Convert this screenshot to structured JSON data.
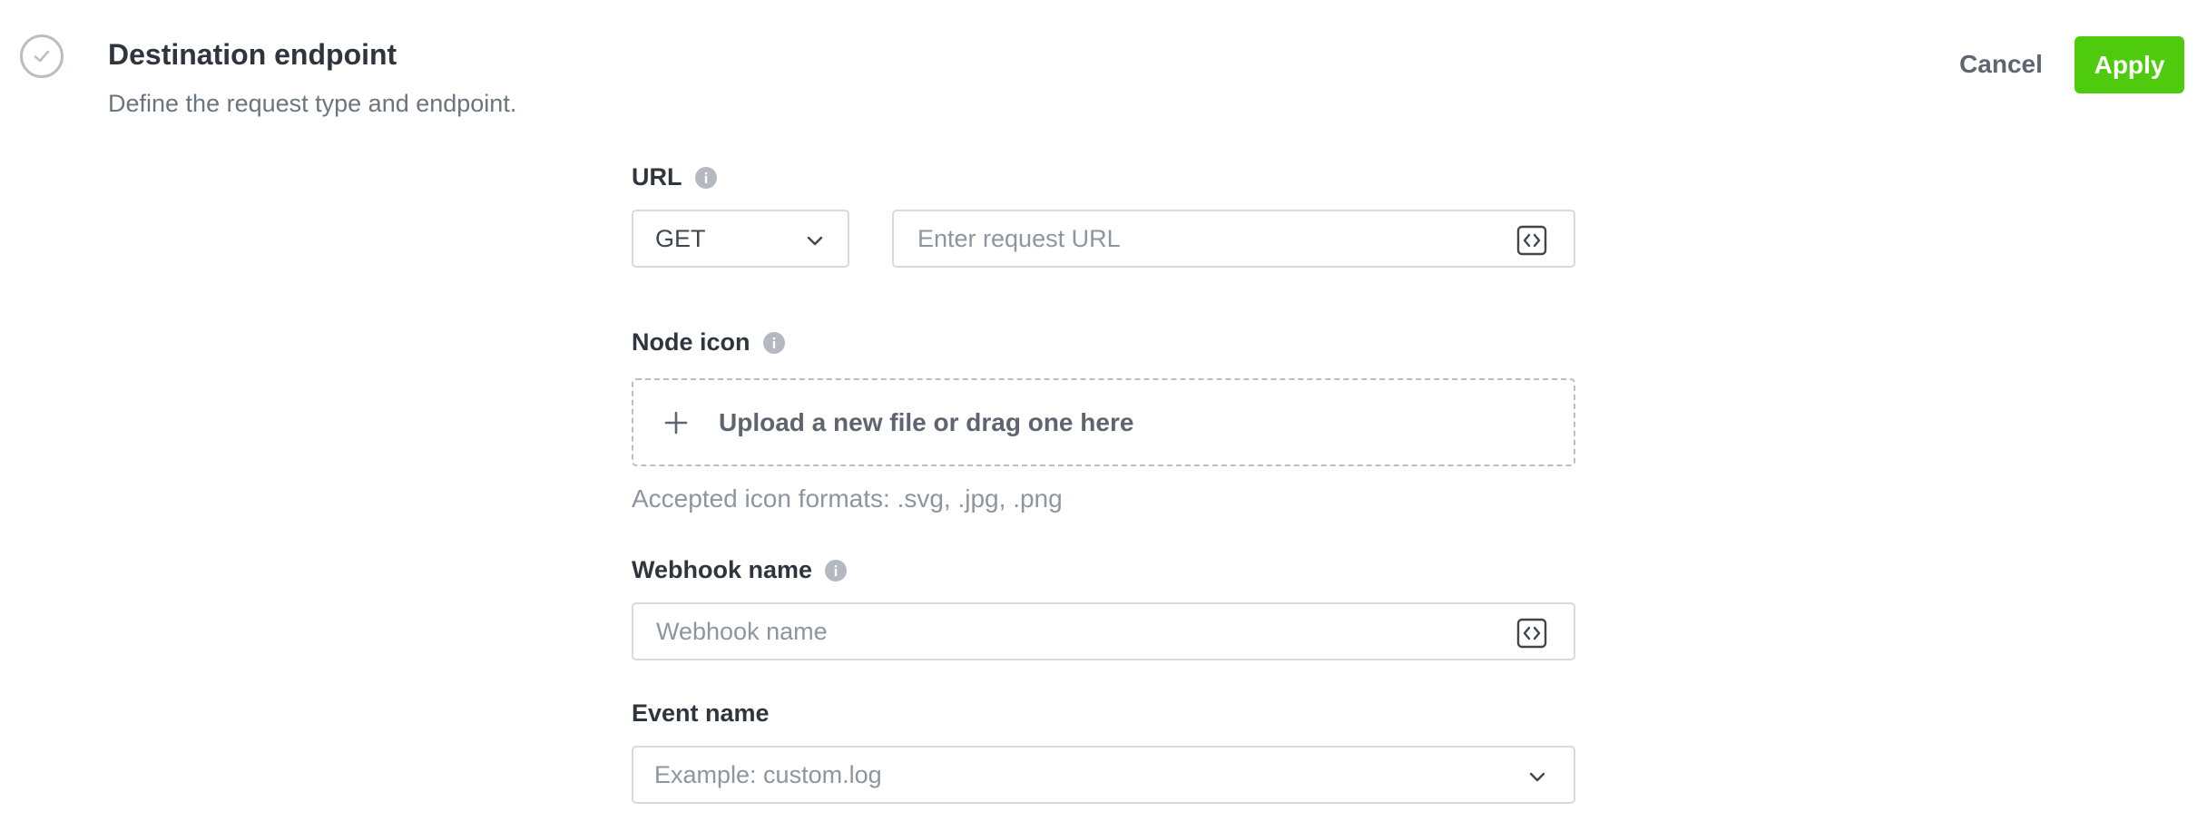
{
  "header": {
    "title": "Destination endpoint",
    "subtitle": "Define the request type and endpoint.",
    "cancel_label": "Cancel",
    "apply_label": "Apply",
    "apply_color": "#4fcb0e"
  },
  "url_section": {
    "label": "URL",
    "method_value": "GET",
    "url_placeholder": "Enter request URL"
  },
  "node_icon": {
    "label": "Node icon",
    "upload_text": "Upload a new file or drag one here",
    "formats_hint": "Accepted icon formats: .svg, .jpg, .png"
  },
  "webhook": {
    "label": "Webhook name",
    "placeholder": "Webhook name"
  },
  "event": {
    "label": "Event name",
    "placeholder": "Example: custom.log"
  }
}
